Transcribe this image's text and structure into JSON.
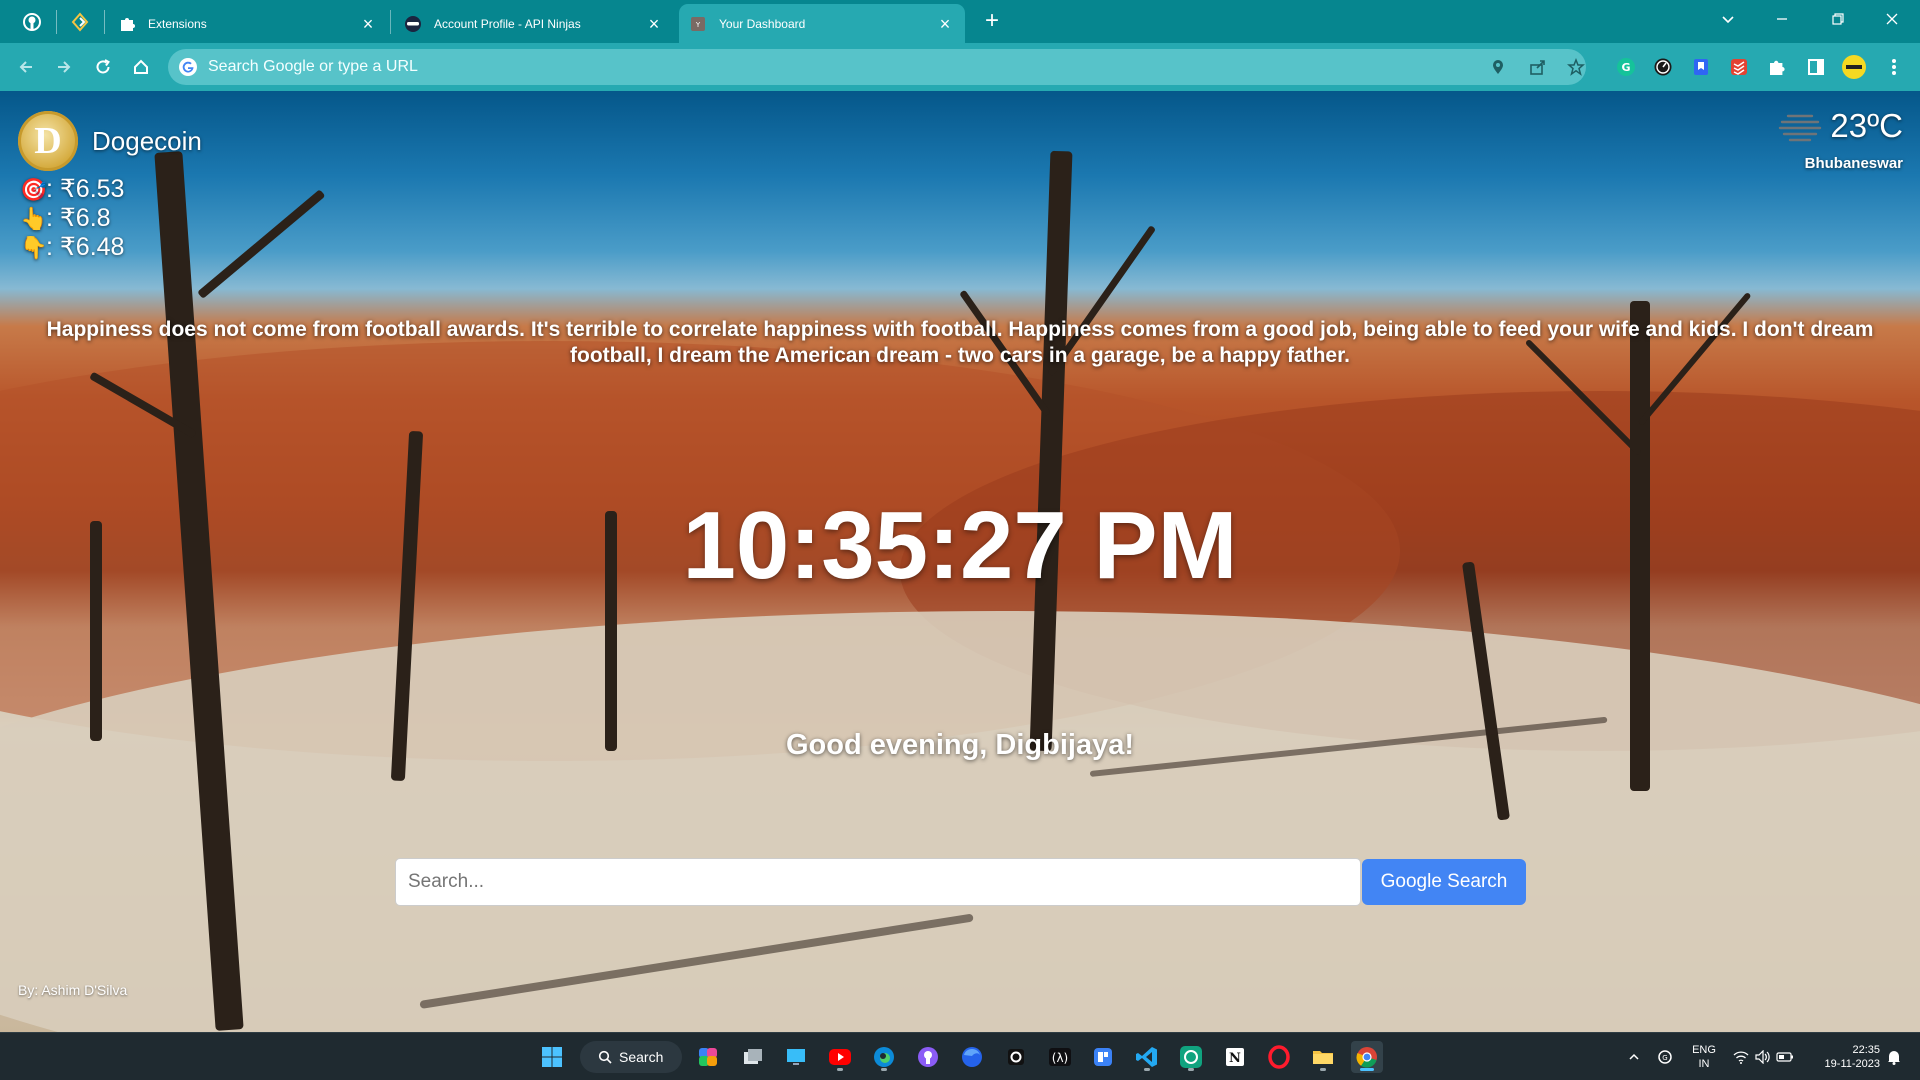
{
  "browser": {
    "tabs": [
      {
        "title": "Extensions",
        "active": false
      },
      {
        "title": "Account Profile - API Ninjas",
        "active": false
      },
      {
        "title": "Your Dashboard",
        "active": true
      }
    ],
    "omnibox_placeholder": "Search Google or type a URL",
    "accent_color": "#26a9b1"
  },
  "crypto": {
    "name": "Dogecoin",
    "logo_letter": "D",
    "prices": [
      {
        "icon": "🎯",
        "value": ": ₹6.53"
      },
      {
        "icon": "👆",
        "value": ": ₹6.8"
      },
      {
        "icon": "👇",
        "value": ": ₹6.48"
      }
    ]
  },
  "weather": {
    "temperature": "23ºC",
    "city": "Bhubaneswar",
    "icon": "mist-icon"
  },
  "quote": "Happiness does not come from football awards. It's terrible to correlate happiness with football. Happiness comes from a good job, being able to feed your wife and kids. I don't dream football, I dream the American dream - two cars in a garage, be a happy father.",
  "clock": "10:35:27 PM",
  "greeting": "Good evening, Digbijaya!",
  "search": {
    "placeholder": "Search...",
    "button_label": "Google Search",
    "button_color": "#4285f4"
  },
  "photo_credit": "By: Ashim D'Silva",
  "taskbar": {
    "search_label": "Search",
    "lang_line1": "ENG",
    "lang_line2": "IN",
    "time": "22:35",
    "date": "19-11-2023"
  }
}
